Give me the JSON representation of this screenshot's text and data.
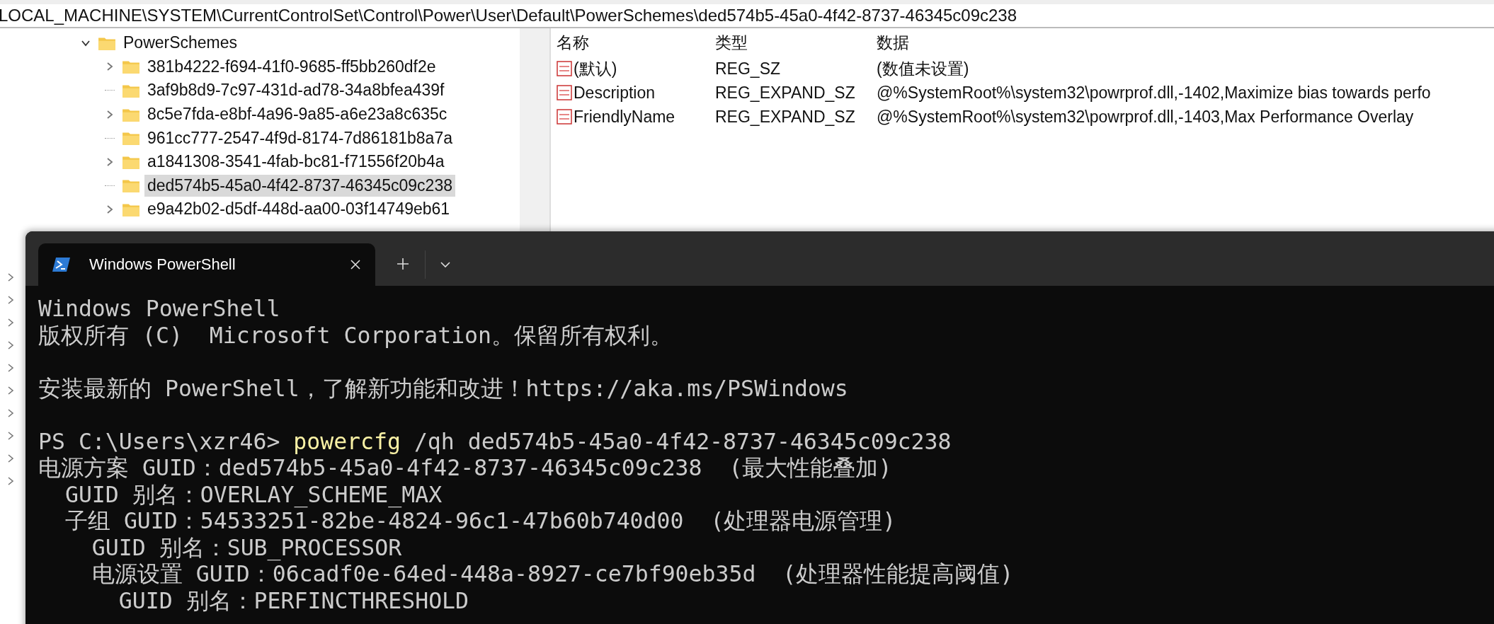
{
  "address_bar": {
    "path": "LOCAL_MACHINE\\SYSTEM\\CurrentControlSet\\Control\\Power\\User\\Default\\PowerSchemes\\ded574b5-45a0-4f42-8737-46345c09c238"
  },
  "tree": {
    "items": [
      {
        "label": "PowerSchemes",
        "expanded": true,
        "selected": false,
        "children": [
          {
            "label": "381b4222-f694-41f0-9685-ff5bb260df2e",
            "has_children": true,
            "selected": false
          },
          {
            "label": "3af9b8d9-7c97-431d-ad78-34a8bfea439f",
            "has_children": false,
            "selected": false
          },
          {
            "label": "8c5e7fda-e8bf-4a96-9a85-a6e23a8c635c",
            "has_children": true,
            "selected": false
          },
          {
            "label": "961cc777-2547-4f9d-8174-7d86181b8a7a",
            "has_children": false,
            "selected": false
          },
          {
            "label": "a1841308-3541-4fab-bc81-f71556f20b4a",
            "has_children": true,
            "selected": false
          },
          {
            "label": "ded574b5-45a0-4f42-8737-46345c09c238",
            "has_children": false,
            "selected": true
          },
          {
            "label": "e9a42b02-d5df-448d-aa00-03f14749eb61",
            "has_children": true,
            "selected": false
          }
        ]
      }
    ]
  },
  "values_table": {
    "columns": [
      "名称",
      "类型",
      "数据"
    ],
    "rows": [
      {
        "name": "(默认)",
        "type": "REG_SZ",
        "data": "(数值未设置)"
      },
      {
        "name": "Description",
        "type": "REG_EXPAND_SZ",
        "data": "@%SystemRoot%\\system32\\powrprof.dll,-1402,Maximize bias towards perfo"
      },
      {
        "name": "FriendlyName",
        "type": "REG_EXPAND_SZ",
        "data": "@%SystemRoot%\\system32\\powrprof.dll,-1403,Max Performance Overlay"
      }
    ]
  },
  "terminal": {
    "tabs": [
      {
        "title": "Windows PowerShell",
        "selected": true
      }
    ],
    "lines": [
      {
        "kind": "text",
        "text": "Windows PowerShell"
      },
      {
        "kind": "text",
        "text": "版权所有 (C)  Microsoft Corporation。保留所有权利。"
      },
      {
        "kind": "blank"
      },
      {
        "kind": "text",
        "text": "安装最新的 PowerShell，了解新功能和改进！https://aka.ms/PSWindows"
      },
      {
        "kind": "blank"
      },
      {
        "kind": "prompt",
        "prompt": "PS C:\\Users\\xzr46>",
        "command": "powercfg",
        "args": "/qh ded574b5-45a0-4f42-8737-46345c09c238"
      },
      {
        "kind": "text",
        "text": "电源方案 GUID：ded574b5-45a0-4f42-8737-46345c09c238  (最大性能叠加)"
      },
      {
        "kind": "text",
        "text": "  GUID 别名：OVERLAY_SCHEME_MAX"
      },
      {
        "kind": "text",
        "text": "  子组 GUID：54533251-82be-4824-96c1-47b60b740d00  (处理器电源管理)"
      },
      {
        "kind": "text",
        "text": "    GUID 别名：SUB_PROCESSOR"
      },
      {
        "kind": "text",
        "text": "    电源设置 GUID：06cadf0e-64ed-448a-8927-ce7bf90eb35d  (处理器性能提高阈值)"
      },
      {
        "kind": "text",
        "text": "      GUID 别名：PERFINCTHRESHOLD"
      }
    ]
  }
}
